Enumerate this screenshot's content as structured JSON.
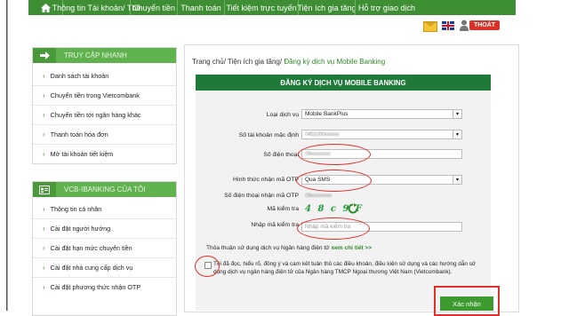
{
  "topnav": {
    "items": [
      "Thông tin Tài khoản/ Thẻ",
      "Chuyển tiền",
      "Thanh toán",
      "Tiết kiệm trực tuyến",
      "Tiện ích gia tăng",
      "Hỗ trợ giao dịch"
    ]
  },
  "header": {
    "logout_label": "THOÁT"
  },
  "sidebar": {
    "quick_title": "TRUY CẬP NHANH",
    "quick_items": [
      "Danh sách tài khoản",
      "Chuyển tiền trong Vietcombank",
      "Chuyển tiền tới ngân hàng khác",
      "Thanh toán hóa đơn",
      "Mở tài khoản tiết kiệm"
    ],
    "ib_title": "VCB-IBANKING CỦA TÔI",
    "ib_items": [
      "Thông tin cá nhân",
      "Cài đặt người hưởng",
      "Cài đặt hạn mức chuyển tiền",
      "Cài đặt nhà cung cấp dịch vụ",
      "Cài đặt phương thức nhận OTP"
    ]
  },
  "breadcrumb": {
    "home": "Trang chủ/ ",
    "section": "Tiện ích gia tăng/ ",
    "current": "Đăng ký dịch vụ Mobile Banking"
  },
  "form": {
    "title": "ĐĂNG KÝ DỊCH VỤ MOBILE BANKING",
    "service_label": "Loại dịch vụ",
    "service_value": "Mobile BankPlus",
    "account_label": "Số tài khoản mặc định",
    "account_value": "0451000xxxxxx",
    "phone_label": "Số điện thoại",
    "phone_value": "09xxxxxxxx",
    "otp_method_label": "Hình thức nhận mã OTP",
    "otp_method_value": "Qua SMS",
    "otp_phone_label": "Số điện thoại nhận mã OTP",
    "otp_phone_value": "09xxxxxxxx",
    "captcha_label": "Mã kiểm tra",
    "captcha_value": "4 8 c 9 F",
    "captcha_input_label": "Nhập mã kiểm tra",
    "captcha_placeholder": "Nhập mã kiểm tra",
    "terms_text": "Thỏa thuận sử dụng dịch vụ Ngân hàng điện tử ",
    "terms_link": "xem chi tiết >>",
    "agree_text": "Tôi đã đọc, hiểu rõ, đồng ý và cam kết tuân thủ các điều khoản, điều kiện sử dụng và các hướng dẫn sử dụng dịch vụ ngân hàng điện tử của Ngân hàng TMCP Ngoại thương Việt Nam (Vietcombank).",
    "submit_label": "Xác nhận"
  },
  "colors": {
    "brand_green": "#3e8f33",
    "header_green": "#1f7a3a",
    "annotation_red": "#e0302a",
    "logout_red": "#d93229"
  }
}
